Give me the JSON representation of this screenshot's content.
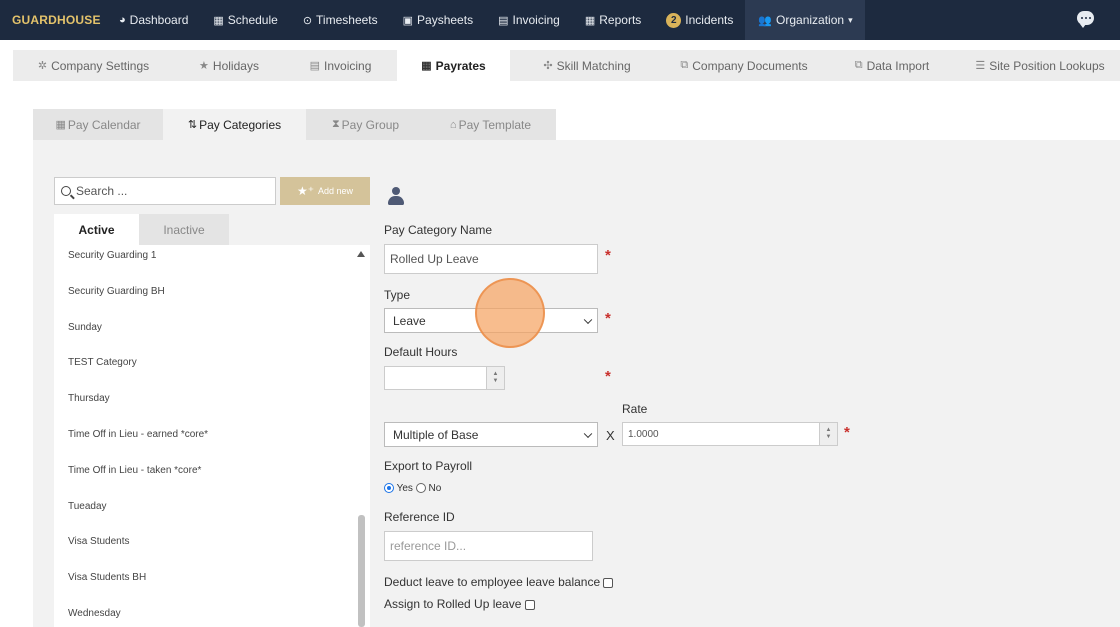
{
  "topnav": {
    "brand": "GUARDHOUSE",
    "items": [
      {
        "label": "Dashboard",
        "icon": "tachometer-icon"
      },
      {
        "label": "Schedule",
        "icon": "calendar-icon"
      },
      {
        "label": "Timesheets",
        "icon": "clock-icon"
      },
      {
        "label": "Paysheets",
        "icon": "money-icon"
      },
      {
        "label": "Invoicing",
        "icon": "invoice-icon"
      },
      {
        "label": "Reports",
        "icon": "table-icon"
      },
      {
        "label": "Incidents",
        "badge": "2"
      },
      {
        "label": "Organization",
        "icon": "users-icon"
      }
    ]
  },
  "settings_tabs": [
    {
      "label": "Company Settings",
      "icon": "gear-icon"
    },
    {
      "label": "Holidays",
      "icon": "star-icon"
    },
    {
      "label": "Invoicing",
      "icon": "invoice-icon"
    },
    {
      "label": "Payrates",
      "icon": "calendar-icon",
      "active": true
    },
    {
      "label": "Skill Matching",
      "icon": "crosshair-icon"
    },
    {
      "label": "Company Documents",
      "icon": "documents-icon"
    },
    {
      "label": "Data Import",
      "icon": "documents-icon"
    },
    {
      "label": "Site Position Lookups",
      "icon": "list-icon"
    }
  ],
  "payrate_tabs": [
    {
      "label": "Pay Calendar",
      "icon": "calendar-icon"
    },
    {
      "label": "Pay Categories",
      "icon": "sort-icon",
      "active": true
    },
    {
      "label": "Pay Group",
      "icon": "hourglass-icon"
    },
    {
      "label": "Pay Template",
      "icon": "bank-icon"
    }
  ],
  "search": {
    "placeholder": "Search ..."
  },
  "add_new_label": "Add new",
  "status_tabs": {
    "active": "Active",
    "inactive": "Inactive"
  },
  "categories": [
    "Security Guarding 1",
    "Security Guarding BH",
    "Sunday",
    "TEST Category",
    "Thursday",
    "Time Off in Lieu - earned *core*",
    "Time Off in Lieu - taken *core*",
    "Tueaday",
    "Visa Students",
    "Visa Students BH",
    "Wednesday"
  ],
  "form": {
    "name_label": "Pay Category Name",
    "name_value": "Rolled Up Leave",
    "type_label": "Type",
    "type_value": "Leave",
    "default_hours_label": "Default Hours",
    "default_hours_value": "",
    "rate_label": "Rate",
    "rate_mode": "Multiple of Base",
    "multiply_sign": "X",
    "rate_value": "1.0000",
    "export_label": "Export to Payroll",
    "export_yes": "Yes",
    "export_no": "No",
    "export_selected": "Yes",
    "reference_label": "Reference ID",
    "reference_placeholder": "reference ID...",
    "deduct_label": "Deduct leave to employee leave balance",
    "assign_label": "Assign to Rolled Up leave",
    "required_mark": "*"
  },
  "colors": {
    "nav_bg": "#1d2a3f",
    "brand": "#e4c36b",
    "add_new_bg": "#d4c39a",
    "required": "#c9302c",
    "radio_selected": "#1a73e8"
  }
}
